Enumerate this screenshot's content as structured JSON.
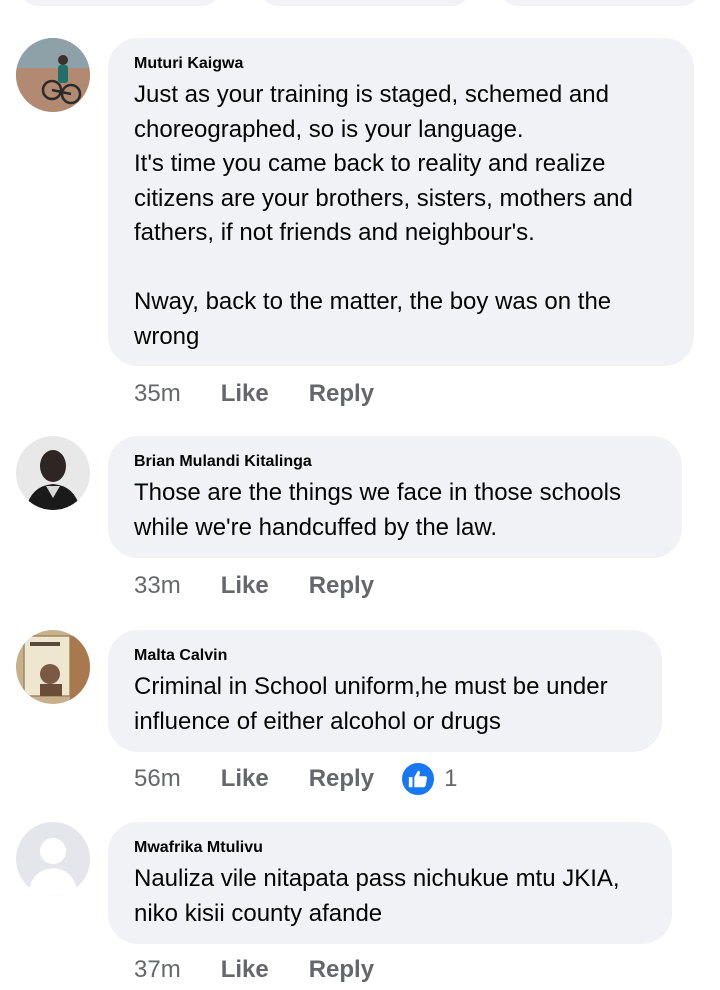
{
  "comments": [
    {
      "author": "Muturi Kaigwa",
      "avatar_icon": "cyclist-photo-avatar",
      "text": "Just as your training is staged, schemed and\nchoreographed, so is your language.\nIt's time you came back to reality and realize\ncitizens are your brothers, sisters, mothers and\nfathers, if not friends and neighbour's.\n\nNway, back to the matter, the boy was on the\nwrong",
      "time": "35m",
      "like_label": "Like",
      "reply_label": "Reply"
    },
    {
      "author": "Brian Mulandi Kitalinga",
      "avatar_icon": "man-portrait-avatar",
      "text": "Those are the things we face in those schools\nwhile we're handcuffed by the law.",
      "time": "33m",
      "like_label": "Like",
      "reply_label": "Reply"
    },
    {
      "author": "Malta Calvin",
      "avatar_icon": "book-photo-avatar",
      "text": "Criminal in School uniform,he must be under\ninfluence of either alcohol or drugs",
      "time": "56m",
      "like_label": "Like",
      "reply_label": "Reply",
      "reaction": {
        "icon": "thumbs-up-icon",
        "count": "1",
        "color": "#1877f2"
      }
    },
    {
      "author": "Mwafrika Mtulivu",
      "avatar_icon": "default-user-avatar",
      "text": "Nauliza vile nitapata pass nichukue mtu JKIA,\nniko kisii county afande",
      "time": "37m",
      "like_label": "Like",
      "reply_label": "Reply"
    }
  ]
}
